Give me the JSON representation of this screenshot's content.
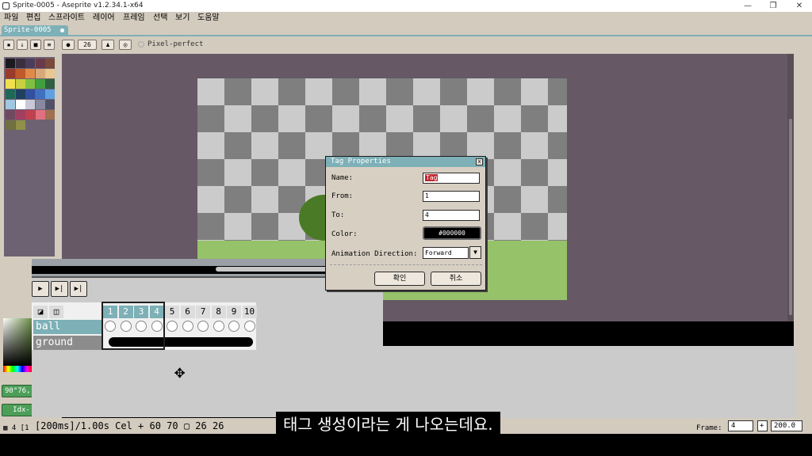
{
  "window": {
    "title": "Sprite-0005 - Aseprite v1.2.34.1-x64"
  },
  "menu": [
    "파일",
    "편집",
    "스프라이트",
    "레이어",
    "프레임",
    "선택",
    "보기",
    "도움말"
  ],
  "tab": {
    "label": "Sprite-0005"
  },
  "context_bar": {
    "brush_size": "26",
    "pixel_perfect_label": "Pixel-perfect"
  },
  "color_panel": {
    "value": "90°76,",
    "index_label": "Idx-"
  },
  "dialog": {
    "title": "Tag Properties",
    "close_label": "x",
    "name_label": "Name:",
    "name_value": "Tag",
    "from_label": "From:",
    "from_value": "1",
    "to_label": "To:",
    "to_value": "4",
    "color_label": "Color:",
    "color_value": "#000000",
    "direction_label": "Animation Direction:",
    "direction_value": "Forward",
    "ok_label": "확인",
    "cancel_label": "취소"
  },
  "timeline": {
    "frames": [
      "1",
      "2",
      "3",
      "4",
      "5",
      "6",
      "7",
      "8",
      "9",
      "10"
    ],
    "active_frames": [
      "1",
      "2",
      "3",
      "4"
    ],
    "layers": [
      "ball",
      "ground"
    ]
  },
  "status": {
    "info": "[200ms]/1.00s Cel + 60 70 ▢ 26 26",
    "frame_label": "Frame:",
    "frame_value": "4",
    "zoom": "200.0"
  },
  "subtitle": "태그 생성이라는 게 나오는데요.",
  "colors": {
    "accent": "#7db0b7",
    "chrome": "#d3cbbe",
    "workspace": "#665865",
    "tag_name_highlight": "#c0262d"
  }
}
